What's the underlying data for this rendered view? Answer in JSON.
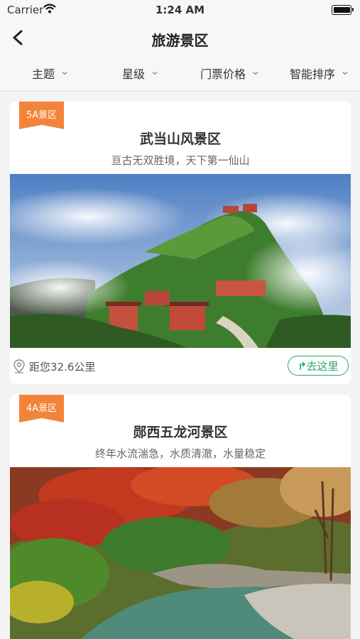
{
  "status_bar": {
    "carrier": "Carrier",
    "time": "1:24 AM",
    "battery_level": 0.9
  },
  "nav": {
    "title": "旅游景区"
  },
  "filters": [
    {
      "label": "主题"
    },
    {
      "label": "星级"
    },
    {
      "label": "门票价格"
    },
    {
      "label": "智能排序"
    }
  ],
  "spots": [
    {
      "tag": "5A景区",
      "name": "武当山风景区",
      "desc": "亘古无双胜境，天下第一仙山",
      "distance": "距您32.6公里",
      "go_label": "去这里"
    },
    {
      "tag": "4A景区",
      "name": "郧西五龙河景区",
      "desc": "终年水流湍急，水质清澈，水量稳定"
    }
  ],
  "colors": {
    "accent_orange": "#f2843a",
    "go_green": "#2aa86b"
  }
}
